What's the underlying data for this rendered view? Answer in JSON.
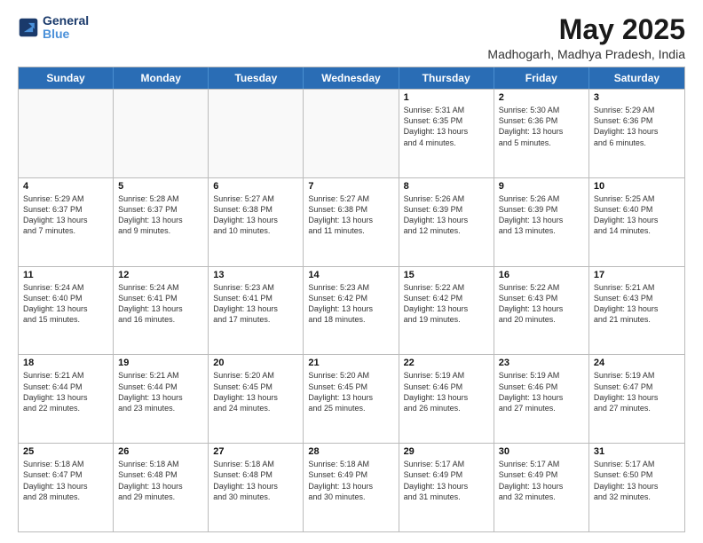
{
  "logo": {
    "line1": "General",
    "line2": "Blue"
  },
  "title": "May 2025",
  "subtitle": "Madhogarh, Madhya Pradesh, India",
  "header_days": [
    "Sunday",
    "Monday",
    "Tuesday",
    "Wednesday",
    "Thursday",
    "Friday",
    "Saturday"
  ],
  "weeks": [
    [
      {
        "day": "",
        "info": ""
      },
      {
        "day": "",
        "info": ""
      },
      {
        "day": "",
        "info": ""
      },
      {
        "day": "",
        "info": ""
      },
      {
        "day": "1",
        "info": "Sunrise: 5:31 AM\nSunset: 6:35 PM\nDaylight: 13 hours\nand 4 minutes."
      },
      {
        "day": "2",
        "info": "Sunrise: 5:30 AM\nSunset: 6:36 PM\nDaylight: 13 hours\nand 5 minutes."
      },
      {
        "day": "3",
        "info": "Sunrise: 5:29 AM\nSunset: 6:36 PM\nDaylight: 13 hours\nand 6 minutes."
      }
    ],
    [
      {
        "day": "4",
        "info": "Sunrise: 5:29 AM\nSunset: 6:37 PM\nDaylight: 13 hours\nand 7 minutes."
      },
      {
        "day": "5",
        "info": "Sunrise: 5:28 AM\nSunset: 6:37 PM\nDaylight: 13 hours\nand 9 minutes."
      },
      {
        "day": "6",
        "info": "Sunrise: 5:27 AM\nSunset: 6:38 PM\nDaylight: 13 hours\nand 10 minutes."
      },
      {
        "day": "7",
        "info": "Sunrise: 5:27 AM\nSunset: 6:38 PM\nDaylight: 13 hours\nand 11 minutes."
      },
      {
        "day": "8",
        "info": "Sunrise: 5:26 AM\nSunset: 6:39 PM\nDaylight: 13 hours\nand 12 minutes."
      },
      {
        "day": "9",
        "info": "Sunrise: 5:26 AM\nSunset: 6:39 PM\nDaylight: 13 hours\nand 13 minutes."
      },
      {
        "day": "10",
        "info": "Sunrise: 5:25 AM\nSunset: 6:40 PM\nDaylight: 13 hours\nand 14 minutes."
      }
    ],
    [
      {
        "day": "11",
        "info": "Sunrise: 5:24 AM\nSunset: 6:40 PM\nDaylight: 13 hours\nand 15 minutes."
      },
      {
        "day": "12",
        "info": "Sunrise: 5:24 AM\nSunset: 6:41 PM\nDaylight: 13 hours\nand 16 minutes."
      },
      {
        "day": "13",
        "info": "Sunrise: 5:23 AM\nSunset: 6:41 PM\nDaylight: 13 hours\nand 17 minutes."
      },
      {
        "day": "14",
        "info": "Sunrise: 5:23 AM\nSunset: 6:42 PM\nDaylight: 13 hours\nand 18 minutes."
      },
      {
        "day": "15",
        "info": "Sunrise: 5:22 AM\nSunset: 6:42 PM\nDaylight: 13 hours\nand 19 minutes."
      },
      {
        "day": "16",
        "info": "Sunrise: 5:22 AM\nSunset: 6:43 PM\nDaylight: 13 hours\nand 20 minutes."
      },
      {
        "day": "17",
        "info": "Sunrise: 5:21 AM\nSunset: 6:43 PM\nDaylight: 13 hours\nand 21 minutes."
      }
    ],
    [
      {
        "day": "18",
        "info": "Sunrise: 5:21 AM\nSunset: 6:44 PM\nDaylight: 13 hours\nand 22 minutes."
      },
      {
        "day": "19",
        "info": "Sunrise: 5:21 AM\nSunset: 6:44 PM\nDaylight: 13 hours\nand 23 minutes."
      },
      {
        "day": "20",
        "info": "Sunrise: 5:20 AM\nSunset: 6:45 PM\nDaylight: 13 hours\nand 24 minutes."
      },
      {
        "day": "21",
        "info": "Sunrise: 5:20 AM\nSunset: 6:45 PM\nDaylight: 13 hours\nand 25 minutes."
      },
      {
        "day": "22",
        "info": "Sunrise: 5:19 AM\nSunset: 6:46 PM\nDaylight: 13 hours\nand 26 minutes."
      },
      {
        "day": "23",
        "info": "Sunrise: 5:19 AM\nSunset: 6:46 PM\nDaylight: 13 hours\nand 27 minutes."
      },
      {
        "day": "24",
        "info": "Sunrise: 5:19 AM\nSunset: 6:47 PM\nDaylight: 13 hours\nand 27 minutes."
      }
    ],
    [
      {
        "day": "25",
        "info": "Sunrise: 5:18 AM\nSunset: 6:47 PM\nDaylight: 13 hours\nand 28 minutes."
      },
      {
        "day": "26",
        "info": "Sunrise: 5:18 AM\nSunset: 6:48 PM\nDaylight: 13 hours\nand 29 minutes."
      },
      {
        "day": "27",
        "info": "Sunrise: 5:18 AM\nSunset: 6:48 PM\nDaylight: 13 hours\nand 30 minutes."
      },
      {
        "day": "28",
        "info": "Sunrise: 5:18 AM\nSunset: 6:49 PM\nDaylight: 13 hours\nand 30 minutes."
      },
      {
        "day": "29",
        "info": "Sunrise: 5:17 AM\nSunset: 6:49 PM\nDaylight: 13 hours\nand 31 minutes."
      },
      {
        "day": "30",
        "info": "Sunrise: 5:17 AM\nSunset: 6:49 PM\nDaylight: 13 hours\nand 32 minutes."
      },
      {
        "day": "31",
        "info": "Sunrise: 5:17 AM\nSunset: 6:50 PM\nDaylight: 13 hours\nand 32 minutes."
      }
    ]
  ],
  "colors": {
    "header_bg": "#2a6db5",
    "cell_border": "#bbb",
    "shaded_bg": "#f0f0f0"
  }
}
